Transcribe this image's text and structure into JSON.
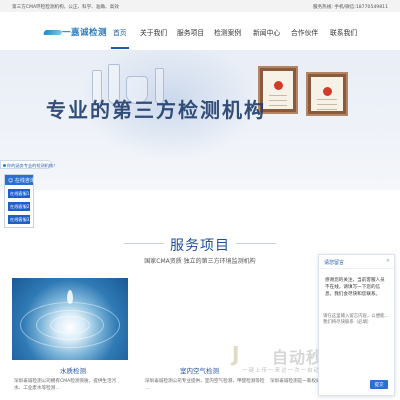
{
  "topbar": {
    "left_text": "第三方CMA环检检测机构，公正、科学、准确、高效",
    "right_text": "服务热线:         手机/微信:18770549811"
  },
  "logo": {
    "text": "一嘉诚检测"
  },
  "nav": {
    "items": [
      {
        "label": "首页",
        "active": true
      },
      {
        "label": "关于我们"
      },
      {
        "label": "服务项目"
      },
      {
        "label": "检测案例"
      },
      {
        "label": "新闻中心"
      },
      {
        "label": "合作伙伴"
      },
      {
        "label": "联系我们"
      }
    ]
  },
  "banner": {
    "headline": "专业的第三方检测机构"
  },
  "side_badge": {
    "text": "你的涵务专业的检测机构！"
  },
  "consult_panel": {
    "title": "在线咨询",
    "buttons": [
      "在线客服1",
      "在线客服2",
      "在线客服3"
    ]
  },
  "services": {
    "title": "服务项目",
    "subtitle": "国家CMA资质 独立的第三方环境监测机构",
    "cards": [
      {
        "title": "水质检测",
        "desc_lines": [
          "深圳泰诚检测公司拥有CMA检测资质，提供生活污",
          "水、工业废水等检测..."
        ]
      },
      {
        "title": "室内空气检测",
        "desc_lines": [
          "深圳泰诚检测公司专业提供，室内空气检测，甲醛检测等检",
          "..."
        ]
      },
      {
        "title": "",
        "desc_lines": [
          "深圳泰诚检测是一家权威"
        ]
      }
    ]
  },
  "chat": {
    "title": "请您留言",
    "close_label": "×",
    "message": "感谢您的关注，当前客服人员不在线，请填写一下您的信息，我们会尽快和您联系。",
    "input_placeholder": "请在这里输入留言内容，以便能... 我们将尽快联系（必填）",
    "send_label": "提交"
  },
  "watermark": {
    "mark": "J",
    "text": "自动秒收录",
    "tagline": "一键上传一来访一次一自动收录"
  }
}
